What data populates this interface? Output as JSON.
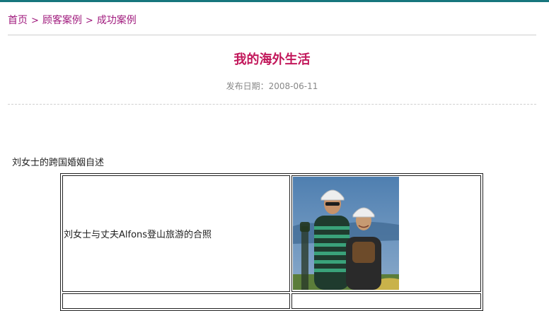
{
  "breadcrumb": {
    "items": [
      "首页",
      "顾客案例",
      "成功案例"
    ],
    "separator": ">"
  },
  "article": {
    "title": "我的海外生活",
    "date_label": "发布日期：",
    "date_value": "2008-06-11",
    "intro": "刘女士的跨国婚姻自述"
  },
  "table": {
    "rows": [
      {
        "caption": "刘女士与丈夫Alfons登山旅游的合照",
        "photo": "couple-hiking-photo"
      }
    ]
  },
  "colors": {
    "accent_bar": "#17767d",
    "link": "#a01a7d",
    "title": "#c2185b",
    "muted": "#888888"
  }
}
